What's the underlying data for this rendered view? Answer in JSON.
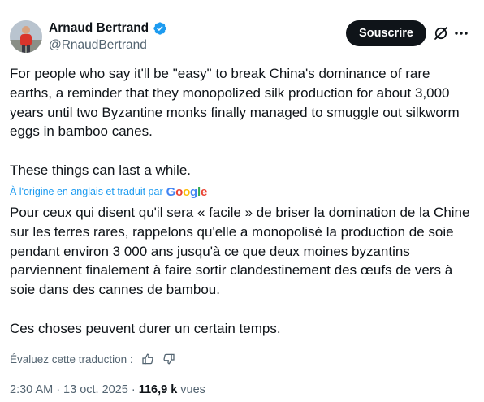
{
  "author": {
    "display_name": "Arnaud Bertrand",
    "handle": "@RnaudBertrand",
    "verified": true
  },
  "actions": {
    "subscribe_label": "Souscrire",
    "grok_icon": "grok-icon",
    "more_icon": "more-icon"
  },
  "tweet": {
    "original_paragraphs": [
      "For people who say it'll be \"easy\" to break China's dominance of rare earths, a reminder that they monopolized silk production for about 3,000 years until two Byzantine monks finally managed to smuggle out silkworm eggs in bamboo canes.",
      "These things can last a while."
    ],
    "translated_note": "À l'origine en anglais et traduit par",
    "translator": "Google",
    "translated_paragraphs": [
      "Pour ceux qui disent qu'il sera « facile » de briser la domination de la Chine sur les terres rares, rappelons qu'elle a monopolisé la production de soie pendant environ 3 000 ans jusqu'à ce que deux moines byzantins parviennent finalement à faire sortir clandestinement des œufs de vers à soie dans des cannes de bambou.",
      "Ces choses peuvent durer un certain temps."
    ]
  },
  "rating": {
    "label": "Évaluez cette traduction :",
    "up_icon": "thumbs-up-icon",
    "down_icon": "thumbs-down-icon"
  },
  "meta": {
    "time": "2:30 AM",
    "separator": "·",
    "date": "13 oct. 2025",
    "views_count": "116,9 k",
    "views_label": "vues"
  },
  "colors": {
    "text": "#0f1419",
    "secondary": "#536471",
    "accent": "#1d9bf0",
    "button_bg": "#0f1419"
  }
}
